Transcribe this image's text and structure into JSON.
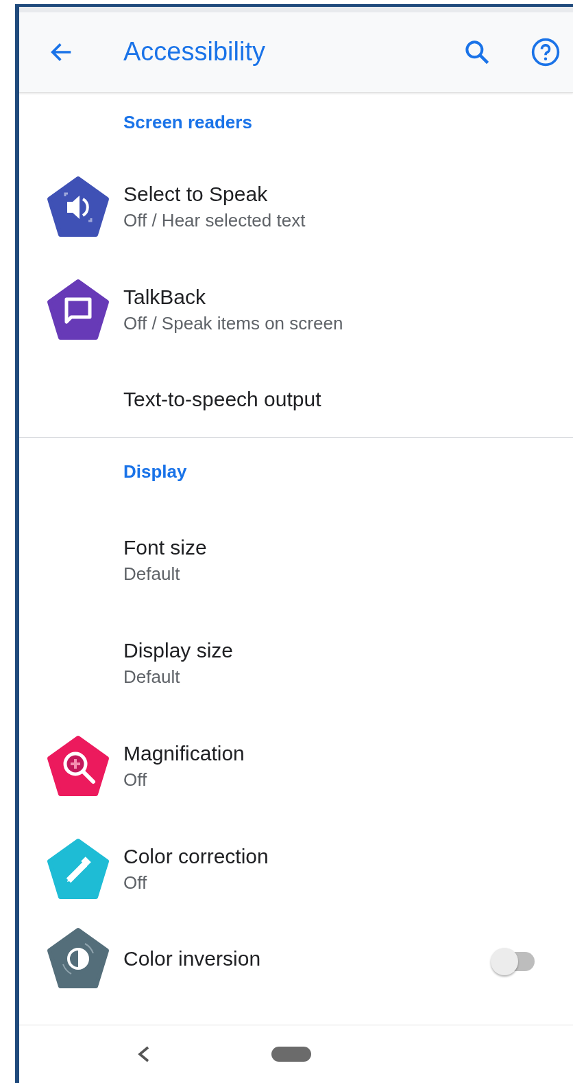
{
  "app_bar": {
    "title": "Accessibility"
  },
  "sections": [
    {
      "title": "Screen readers",
      "items": [
        {
          "kind": "row",
          "title": "Select to Speak",
          "summary": "Off / Hear selected text"
        },
        {
          "kind": "row",
          "title": "TalkBack",
          "summary": "Off / Speak items on screen"
        },
        {
          "kind": "row",
          "title": "Text-to-speech output"
        }
      ]
    },
    {
      "title": "Display",
      "items": [
        {
          "kind": "row",
          "title": "Font size",
          "summary": "Default"
        },
        {
          "kind": "row",
          "title": "Display size",
          "summary": "Default"
        },
        {
          "kind": "row",
          "title": "Magnification",
          "summary": "Off"
        },
        {
          "kind": "row",
          "title": "Color correction",
          "summary": "Off"
        },
        {
          "kind": "toggle",
          "title": "Color inversion",
          "on": false
        }
      ]
    }
  ]
}
